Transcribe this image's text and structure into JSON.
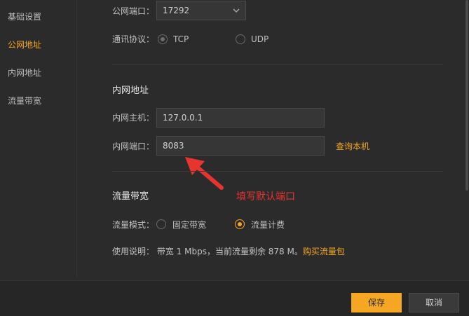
{
  "sidebar": {
    "items": [
      {
        "label": "基础设置"
      },
      {
        "label": "公网地址"
      },
      {
        "label": "内网地址"
      },
      {
        "label": "流量带宽"
      }
    ]
  },
  "public": {
    "port_label": "公网端口：",
    "port_value": "17292",
    "protocol_label": "通讯协议：",
    "protocol_options": [
      "TCP",
      "UDP"
    ]
  },
  "intranet": {
    "title": "内网地址",
    "host_label": "内网主机：",
    "host_value": "127.0.0.1",
    "port_label": "内网端口：",
    "port_value": "8083",
    "query_link": "查询本机"
  },
  "annotation": {
    "text": "填写默认端口"
  },
  "bandwidth": {
    "title": "流量带宽",
    "mode_label": "流量模式：",
    "mode_options": [
      "固定带宽",
      "流量计费"
    ],
    "usage_label": "使用说明：",
    "usage_text": "带宽 1 Mbps，当前流量剩余 878 M。",
    "buy_link": "购买流量包"
  },
  "footer": {
    "save_label": "保存",
    "cancel_label": "取消"
  },
  "colors": {
    "accent": "#f5a623",
    "annotation": "#e8342f",
    "background": "#2b2b2b"
  }
}
